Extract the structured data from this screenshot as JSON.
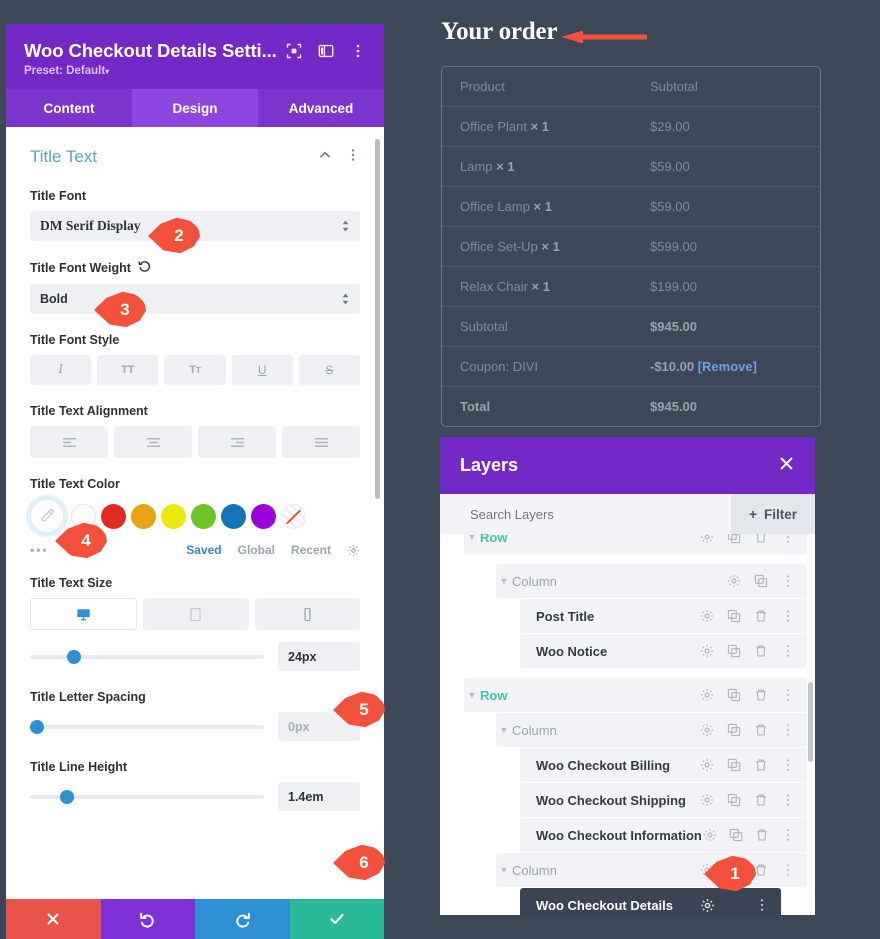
{
  "settings_panel": {
    "title": "Woo Checkout Details Setti...",
    "preset": "Preset: Default",
    "preset_caret": "▾",
    "header_icons": [
      "expand-icon",
      "split-view-icon",
      "more-vertical-icon"
    ],
    "tabs": [
      {
        "label": "Content",
        "active": false
      },
      {
        "label": "Design",
        "active": true
      },
      {
        "label": "Advanced",
        "active": false
      }
    ],
    "section": {
      "title": "Title Text",
      "collapse_icon": "chevron-up-icon",
      "more_icon": "more-vertical-icon"
    },
    "fields": {
      "title_font": {
        "label": "Title Font",
        "value": "DM Serif Display"
      },
      "title_font_weight": {
        "label": "Title Font Weight",
        "value": "Bold",
        "reset_icon": "reset-icon"
      },
      "title_font_style": {
        "label": "Title Font Style",
        "buttons": [
          "I",
          "TT",
          "Tт",
          "U",
          "S"
        ],
        "names": [
          "italic",
          "uppercase",
          "smallcaps",
          "underline",
          "strikethrough"
        ]
      },
      "title_text_alignment": {
        "label": "Title Text Alignment",
        "options": [
          "align-left",
          "align-center",
          "align-right",
          "align-justify"
        ]
      },
      "title_text_color": {
        "label": "Title Text Color",
        "selected": "eyedropper",
        "swatches": [
          "#ffffff",
          "#e02b20",
          "#e8a317",
          "#ebe80f",
          "#6cc428",
          "#1574b8",
          "#9b00d9",
          "transparent"
        ],
        "more_dots": "•••",
        "links": [
          "Saved",
          "Global",
          "Recent"
        ],
        "active_link": "Saved",
        "gear_icon": "gear-icon"
      },
      "title_text_size": {
        "label": "Title Text Size",
        "devices": [
          "desktop",
          "tablet",
          "phone"
        ],
        "active_device": "desktop",
        "value": "24px",
        "slider_pct": 16
      },
      "title_letter_spacing": {
        "label": "Title Letter Spacing",
        "value": "0px",
        "slider_pct": 0
      },
      "title_line_height": {
        "label": "Title Line Height",
        "value": "1.4em",
        "slider_pct": 13
      }
    },
    "footer_buttons": [
      {
        "name": "cancel-button",
        "icon": "✕",
        "color": "#e8534c"
      },
      {
        "name": "undo-button",
        "icon": "↺",
        "color": "#7f31d8"
      },
      {
        "name": "redo-button",
        "icon": "↻",
        "color": "#2f8fd4"
      },
      {
        "name": "save-button",
        "icon": "✔",
        "color": "#2bb99b"
      }
    ]
  },
  "order": {
    "heading": "Your order",
    "columns": [
      "Product",
      "Subtotal"
    ],
    "rows": [
      {
        "product": "Office Plant",
        "qty": "× 1",
        "subtotal": "$29.00",
        "bold": false
      },
      {
        "product": "Lamp",
        "qty": "× 1",
        "subtotal": "$59.00",
        "bold": false
      },
      {
        "product": "Office Lamp",
        "qty": "× 1",
        "subtotal": "$59.00",
        "bold": false
      },
      {
        "product": "Office Set-Up",
        "qty": "× 1",
        "subtotal": "$599.00",
        "bold": false
      },
      {
        "product": "Relax Chair",
        "qty": "× 1",
        "subtotal": "$199.00",
        "bold": false
      }
    ],
    "summary": [
      {
        "label": "Subtotal",
        "value": "$945.00",
        "link": ""
      },
      {
        "label": "Coupon: DIVI",
        "value": "-$10.00",
        "link": "[Remove]"
      },
      {
        "label": "Total",
        "value": "$945.00",
        "link": ""
      }
    ]
  },
  "layers": {
    "title": "Layers",
    "close_icon": "close-icon",
    "search_placeholder": "Search Layers",
    "filter_label": "Filter",
    "filter_plus": "+",
    "items": [
      {
        "label": "Row",
        "type": "row",
        "indent": 0,
        "shade": true,
        "clipped": true,
        "actions": [
          "gear",
          "duplicate",
          "trash",
          "more"
        ]
      },
      {
        "label": "Column",
        "type": "column",
        "indent": 1,
        "shade": true,
        "clipped": false,
        "actions": [
          "gear",
          "duplicate",
          "more"
        ]
      },
      {
        "label": "Post Title",
        "type": "module",
        "indent": 2,
        "shade": true,
        "clipped": false,
        "actions": [
          "gear",
          "duplicate",
          "trash",
          "more"
        ]
      },
      {
        "label": "Woo Notice",
        "type": "module",
        "indent": 2,
        "shade": true,
        "clipped": false,
        "actions": [
          "gear",
          "duplicate",
          "trash",
          "more"
        ]
      },
      {
        "label": "Row",
        "type": "row",
        "indent": 0,
        "shade": true,
        "clipped": false,
        "actions": [
          "gear",
          "duplicate",
          "trash",
          "more"
        ]
      },
      {
        "label": "Column",
        "type": "column",
        "indent": 1,
        "shade": true,
        "clipped": false,
        "actions": [
          "gear",
          "duplicate",
          "trash",
          "more"
        ]
      },
      {
        "label": "Woo Checkout Billing",
        "type": "module",
        "indent": 2,
        "shade": true,
        "clipped": false,
        "actions": [
          "gear",
          "duplicate",
          "trash",
          "more"
        ]
      },
      {
        "label": "Woo Checkout Shipping",
        "type": "module",
        "indent": 2,
        "shade": true,
        "clipped": false,
        "actions": [
          "gear",
          "duplicate",
          "trash",
          "more"
        ]
      },
      {
        "label": "Woo Checkout Information",
        "type": "module",
        "indent": 2,
        "shade": true,
        "clipped": false,
        "actions": [
          "gear",
          "duplicate",
          "trash",
          "more"
        ]
      },
      {
        "label": "Column",
        "type": "column",
        "indent": 1,
        "shade": true,
        "clipped": false,
        "actions": [
          "gear",
          "duplicate",
          "trash",
          "more"
        ]
      },
      {
        "label": "Woo Checkout Details",
        "type": "module-selected",
        "indent": 2,
        "shade": false,
        "clipped": false,
        "actions": [
          "gear",
          "more"
        ]
      }
    ]
  },
  "callouts": [
    {
      "num": "1",
      "target": "layers-selected-row-gear"
    },
    {
      "num": "2",
      "target": "title-font-select"
    },
    {
      "num": "3",
      "target": "title-font-weight-select"
    },
    {
      "num": "4",
      "target": "title-text-color-swatch"
    },
    {
      "num": "5",
      "target": "title-text-size-value"
    },
    {
      "num": "6",
      "target": "title-line-height-value"
    }
  ],
  "annotation_arrow": {
    "name": "red-arrow-pointing-left",
    "color": "#f4503c"
  }
}
